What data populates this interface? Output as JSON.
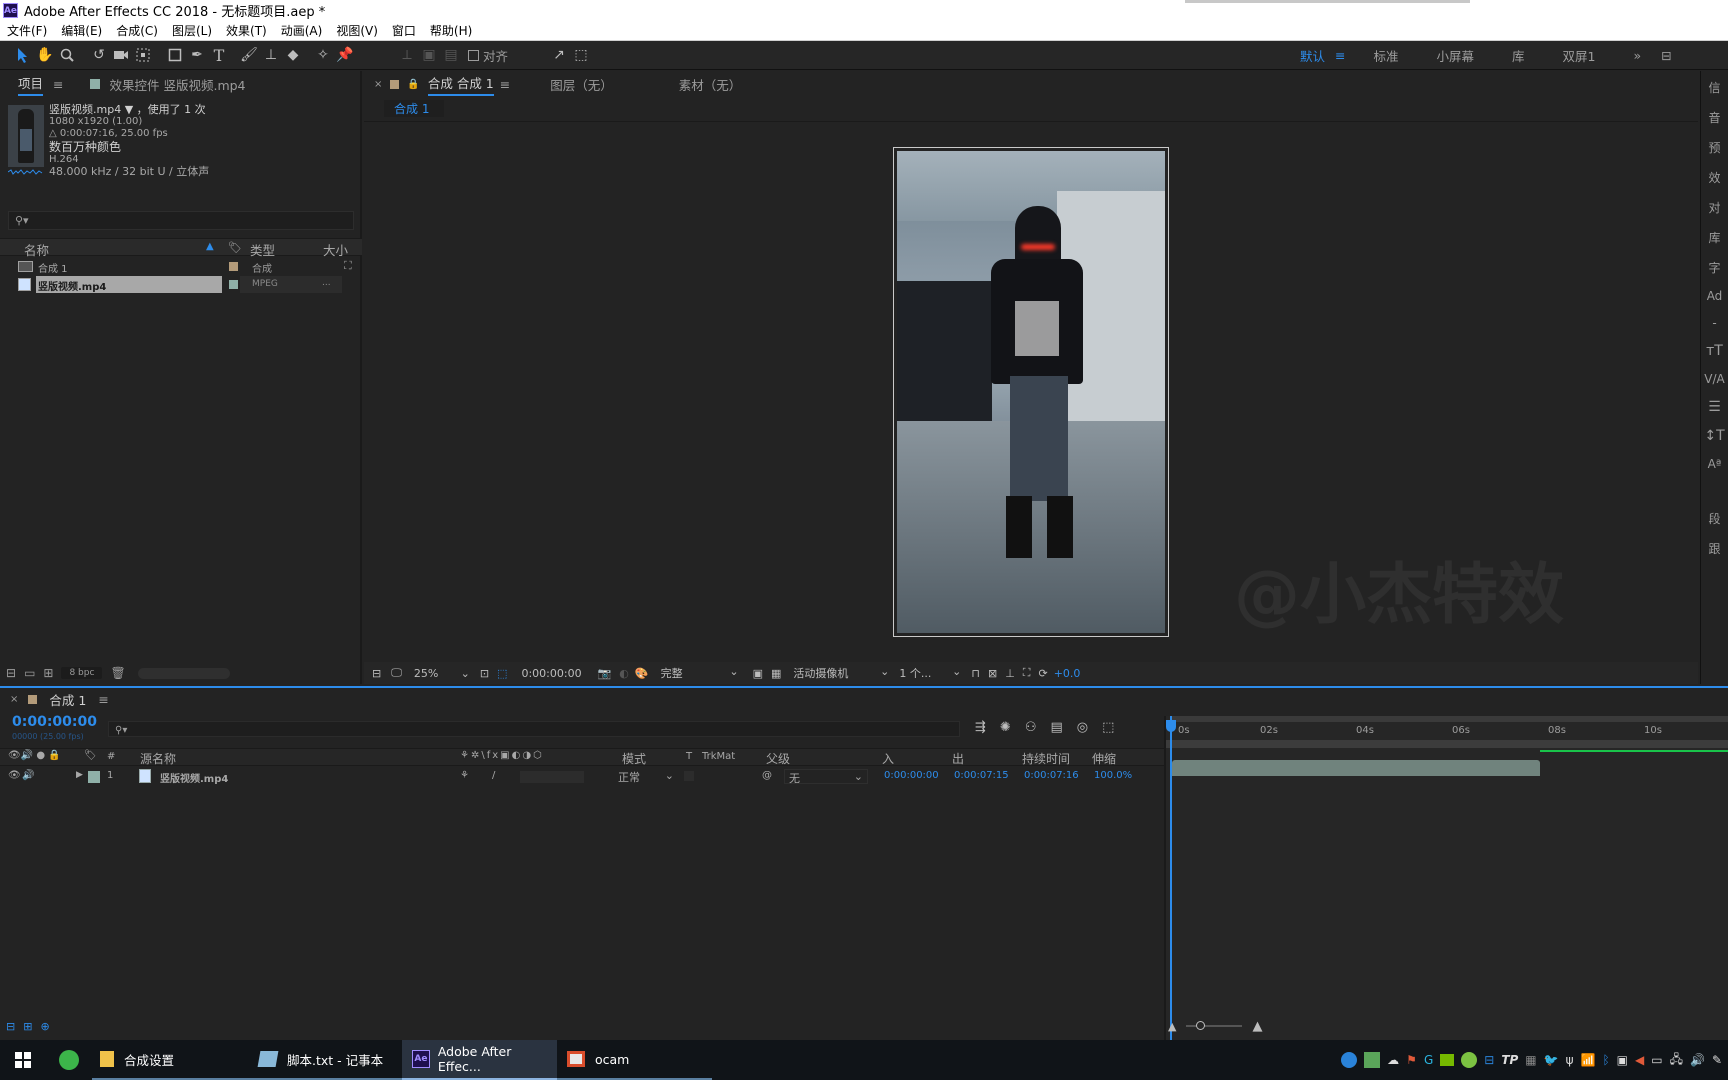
{
  "window": {
    "title": "Adobe After Effects CC 2018 - 无标题项目.aep *",
    "logo": "Ae"
  },
  "menu": [
    "文件(F)",
    "编辑(E)",
    "合成(C)",
    "图层(L)",
    "效果(T)",
    "动画(A)",
    "视图(V)",
    "窗口",
    "帮助(H)"
  ],
  "toolbar": {
    "snap_label": "对齐",
    "workspaces": [
      "默认",
      "标准",
      "小屏幕",
      "库",
      "双屏1"
    ],
    "active_workspace": "默认"
  },
  "project": {
    "tab_label": "项目",
    "effects_tab_label": "效果控件 竖版视频.mp4",
    "asset": {
      "name": "竖版视频.mp4",
      "used": "，使用了 1 次",
      "dimensions": "1080 x1920 (1.00)",
      "duration": "△ 0:00:07:16, 25.00 fps",
      "colors": "数百万种颜色",
      "codec": "H.264",
      "audio": "48.000 kHz / 32 bit U / 立体声"
    },
    "search_placeholder": "",
    "columns": {
      "name": "名称",
      "type": "类型",
      "size": "大小"
    },
    "items": [
      {
        "name": "合成 1",
        "type": "合成",
        "size": "",
        "icon": "composition-icon"
      },
      {
        "name": "竖版视频.mp4",
        "type": "MPEG",
        "size": "...",
        "icon": "footage-icon",
        "selected": true
      }
    ],
    "bpc": "8 bpc"
  },
  "viewer": {
    "comp_tab": "合成 合成 1",
    "layer_tab": "图层（无）",
    "footage_tab": "素材（无）",
    "flow_label": "合成 1",
    "zoom": "25%",
    "timecode": "0:00:00:00",
    "resolution": "完整",
    "camera": "活动摄像机",
    "views": "1 个...",
    "exposure": "+0.0",
    "watermark": "@小杰特效"
  },
  "rightpanel": {
    "labels": [
      "信",
      "音",
      "预",
      "效",
      "对",
      "库",
      "字",
      "Ad",
      "-",
      "段",
      "跟"
    ]
  },
  "timeline": {
    "tab_label": "合成 1",
    "current_time": "0:00:00:00",
    "frame_info": "00000 (25.00 fps)",
    "columns": {
      "num": "#",
      "source_name": "源名称",
      "mode": "模式",
      "t": "T",
      "trkmat": "TrkMat",
      "parent": "父级",
      "in": "入",
      "out": "出",
      "duration": "持续时间",
      "stretch": "伸缩"
    },
    "ruler": [
      "0s",
      "02s",
      "04s",
      "06s",
      "08s",
      "10s"
    ],
    "layers": [
      {
        "index": "1",
        "name": "竖版视频.mp4",
        "mode": "正常",
        "parent": "无",
        "in": "0:00:00:00",
        "out": "0:00:07:15",
        "duration": "0:00:07:16",
        "stretch": "100.0%"
      }
    ],
    "colors": {
      "layer_bar": "#8aa39b",
      "work_area": "#2d8ceb",
      "green": "#19c34a"
    }
  },
  "taskbar": {
    "items": [
      {
        "label": "合成设置",
        "icon": "folder-icon"
      },
      {
        "label": "脚本.txt - 记事本",
        "icon": "notepad-icon"
      },
      {
        "label": "Adobe After Effec...",
        "icon": "after-effects-icon",
        "active": true
      },
      {
        "label": "ocam",
        "icon": "ocam-icon"
      }
    ]
  }
}
